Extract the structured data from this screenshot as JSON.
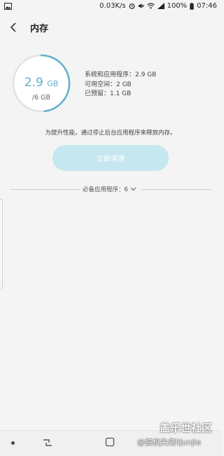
{
  "status_bar": {
    "net_speed": "0.03K/s",
    "battery": "100%",
    "time": "07:46"
  },
  "header": {
    "title": "内存"
  },
  "memory": {
    "used_value": "2.9",
    "used_unit": "GB",
    "total": "/6 GB",
    "used_fraction": 0.48,
    "system_apps": "系统和应用程序：2.9 GB",
    "available": "可用空间：2 GB",
    "reserved": "已预留：1.1 GB",
    "hint": "为提升性能，通过停止后台应用程序来释放内存。",
    "clean_button": "立即清理"
  },
  "section": {
    "label": "必备应用程序：6"
  },
  "watermark": {
    "site": "盖乐世社区",
    "author": "@搞机失佬lijunjie"
  },
  "colors": {
    "accent": "#5eb2c8",
    "button_bg": "#c5e7ef"
  }
}
